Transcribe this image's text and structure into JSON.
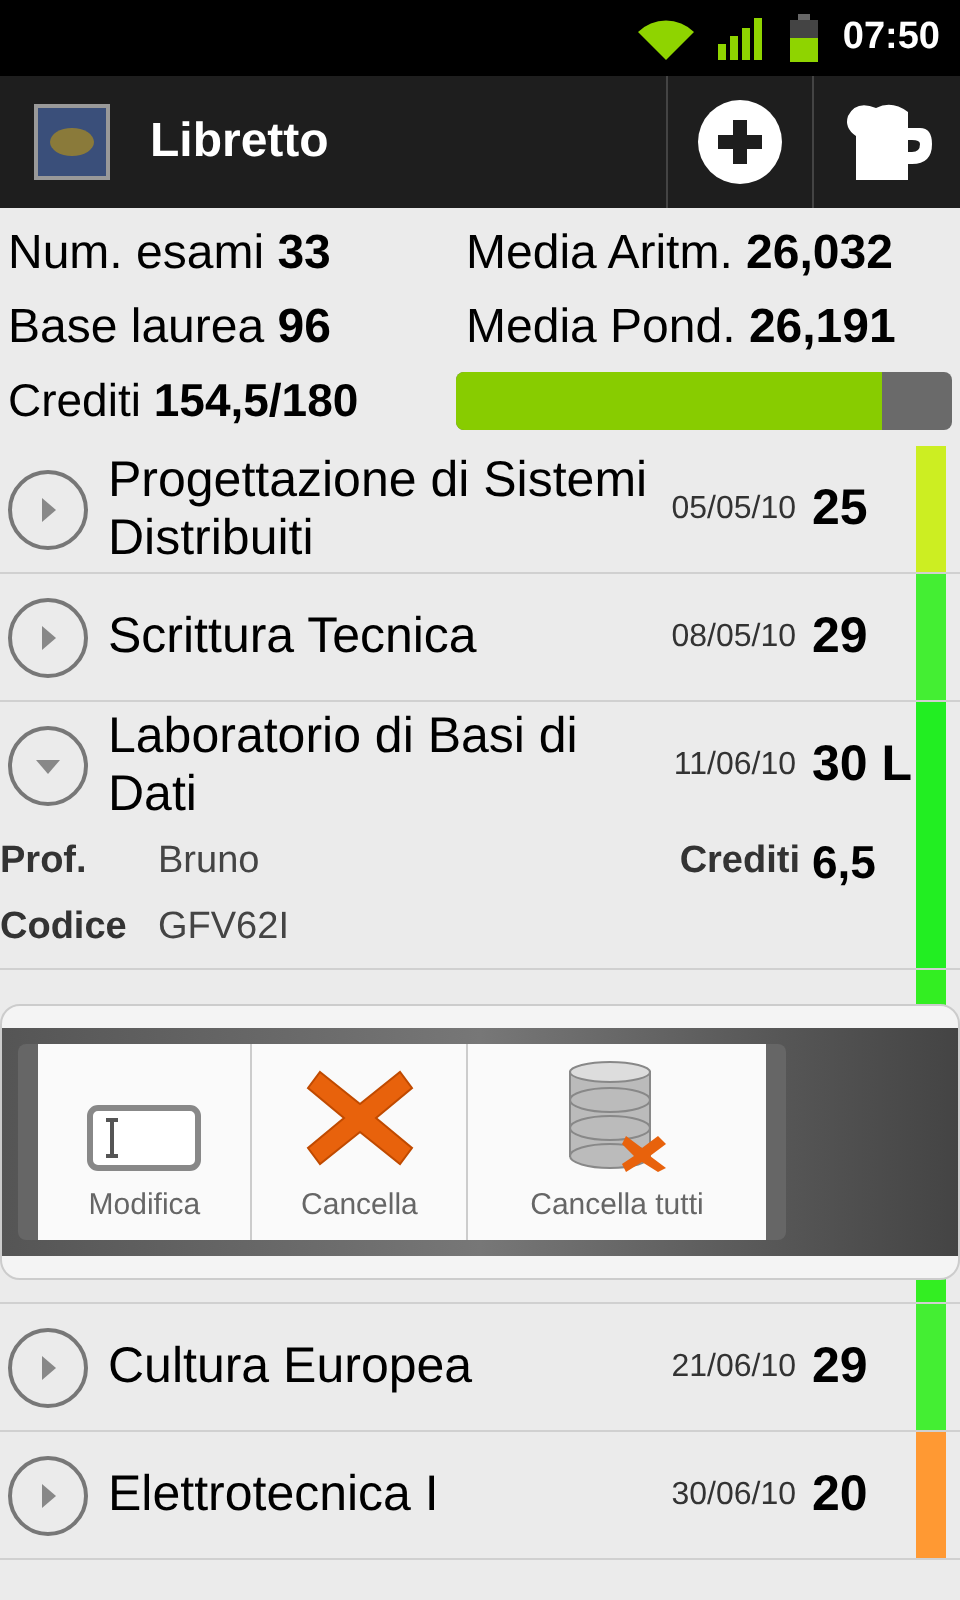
{
  "status_bar": {
    "time": "07:50"
  },
  "action_bar": {
    "title": "Libretto"
  },
  "stats": {
    "num_esami_label": "Num. esami",
    "num_esami": "33",
    "media_aritm_label": "Media Aritm.",
    "media_aritm": "26,032",
    "base_laurea_label": "Base laurea",
    "base_laurea": "96",
    "media_pond_label": "Media Pond.",
    "media_pond": "26,191",
    "crediti_label": "Crediti",
    "crediti": "154,5/180",
    "level": 0.86
  },
  "exams": [
    {
      "name": "Progettazione di Sistemi Distribuiti",
      "date": "05/05/10",
      "grade": "25",
      "expanded": false,
      "color": "#ccee22"
    },
    {
      "name": "Scrittura Tecnica",
      "date": "08/05/10",
      "grade": "29",
      "expanded": false,
      "color": "#44ee33"
    },
    {
      "name": "Laboratorio di Basi di Dati",
      "date": "11/06/10",
      "grade": "30 L",
      "expanded": true,
      "color": "#22ee22",
      "prof_label": "Prof.",
      "prof": "Bruno",
      "crediti_label": "Crediti",
      "crediti": "6,5",
      "codice_label": "Codice",
      "codice": "GFV62I"
    },
    {
      "name": "Cultura Europea",
      "date": "21/06/10",
      "grade": "29",
      "expanded": false,
      "color": "#44ee33"
    },
    {
      "name": "Elettrotecnica I",
      "date": "30/06/10",
      "grade": "20",
      "expanded": false,
      "color": "#ff9933"
    }
  ],
  "context_menu": {
    "items": [
      {
        "kind": "edit",
        "label": "Modifica"
      },
      {
        "kind": "delete",
        "label": "Cancella"
      },
      {
        "kind": "delete_all",
        "label": "Cancella tutti"
      }
    ]
  }
}
